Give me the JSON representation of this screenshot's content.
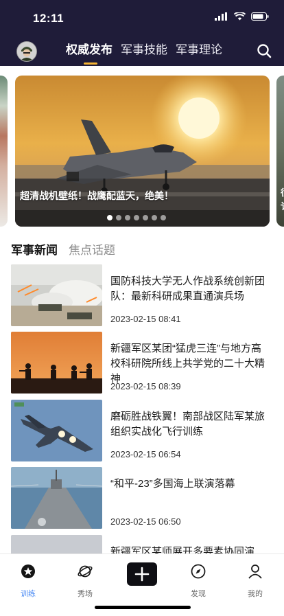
{
  "status_bar": {
    "time": "12:11"
  },
  "header": {
    "tabs": [
      {
        "label": "权威发布",
        "active": true
      },
      {
        "label": "军事技能",
        "active": false
      },
      {
        "label": "军事理论",
        "active": false
      }
    ],
    "accent_color": "#f5b433",
    "background": "#1f1c39"
  },
  "banner": {
    "caption": "超清战机壁纸！战鹰配蓝天，绝美！",
    "right_peek_text": [
      "很",
      "讠"
    ],
    "dot_count": 7,
    "active_dot": 0
  },
  "section": {
    "tabs": [
      {
        "label": "军事新闻",
        "active": true
      },
      {
        "label": "焦点话题",
        "active": false
      }
    ]
  },
  "news": [
    {
      "title": "国防科技大学无人作战系统创新团队：最新科研成果直通演兵场",
      "time": "2023-02-15 08:41"
    },
    {
      "title": "新疆军区某团“猛虎三连”与地方高校科研院所线上共学党的二十大精神",
      "time": "2023-02-15 08:39"
    },
    {
      "title": "磨砺胜战铁翼！南部战区陆军某旅组织实战化飞行训练",
      "time": "2023-02-15 06:54"
    },
    {
      "title": "“和平-23”多国海上联演落幕",
      "time": "2023-02-15 06:50"
    },
    {
      "title": "新疆军区某师展开多要素协同演",
      "time": ""
    }
  ],
  "bottom_nav": {
    "items": [
      {
        "label": "训练",
        "icon": "star-badge-icon",
        "active": true
      },
      {
        "label": "秀场",
        "icon": "planet-icon",
        "active": false
      },
      {
        "label": "",
        "icon": "plus-icon",
        "active": false
      },
      {
        "label": "发现",
        "icon": "compass-icon",
        "active": false
      },
      {
        "label": "我的",
        "icon": "person-icon",
        "active": false
      }
    ],
    "active_color": "#4b8bf4"
  }
}
